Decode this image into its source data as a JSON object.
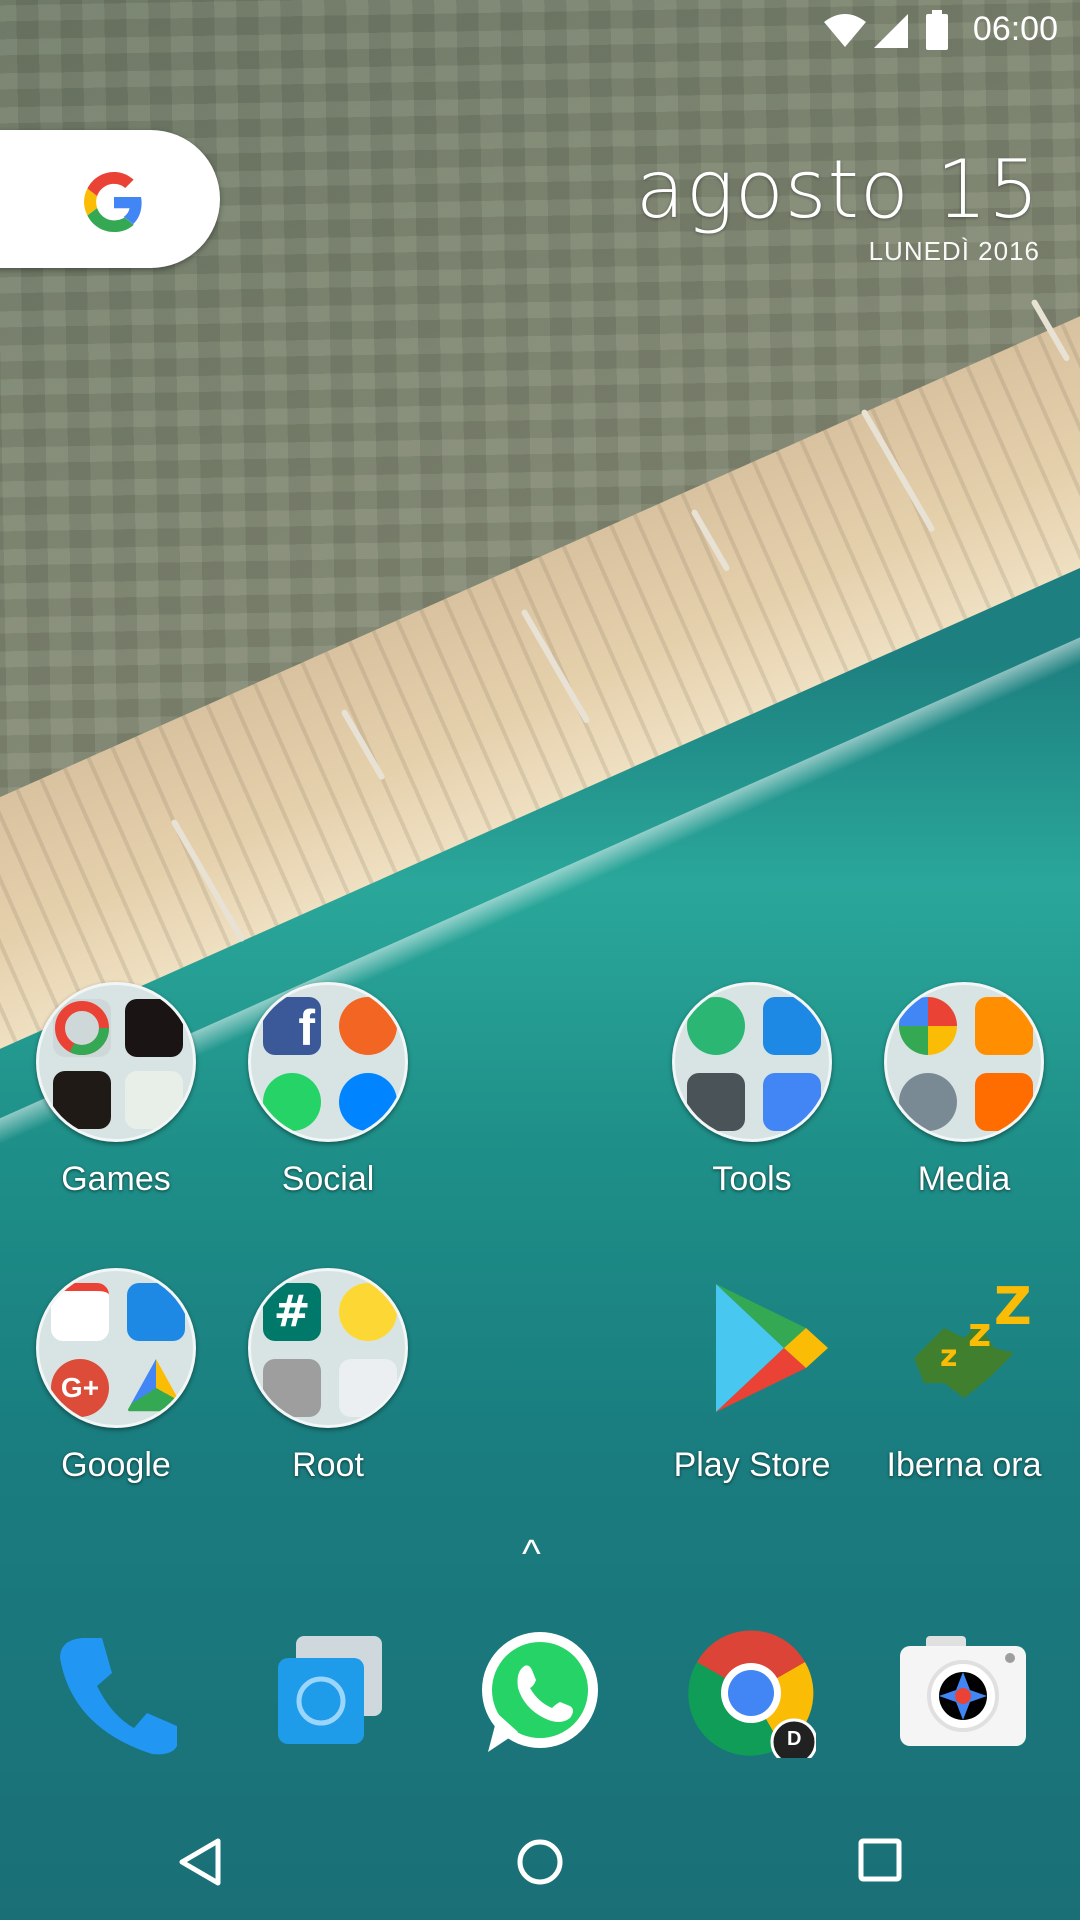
{
  "status_bar": {
    "time": "06:00",
    "icons": [
      "wifi-icon",
      "cell-signal-icon",
      "battery-icon"
    ]
  },
  "search_widget": {
    "icon": "google-g-icon"
  },
  "date_widget": {
    "date": "agosto 15",
    "weekday_year": "LUNEDÌ 2016"
  },
  "apps": [
    {
      "label": "Games",
      "type": "folder"
    },
    {
      "label": "Social",
      "type": "folder"
    },
    {
      "label": "Tools",
      "type": "folder"
    },
    {
      "label": "Media",
      "type": "folder"
    },
    {
      "label": "Google",
      "type": "folder"
    },
    {
      "label": "Root",
      "type": "folder"
    },
    {
      "label": "Play Store",
      "type": "app"
    },
    {
      "label": "Iberna ora",
      "type": "app"
    }
  ],
  "drawer_handle": "^",
  "dock": [
    {
      "name": "phone-icon"
    },
    {
      "name": "messages-icon"
    },
    {
      "name": "whatsapp-icon"
    },
    {
      "name": "chrome-icon",
      "badge": "D"
    },
    {
      "name": "camera-icon"
    }
  ],
  "nav_bar": [
    "back-icon",
    "home-icon",
    "recents-icon"
  ],
  "colors": {
    "sea": "#1d7f7f",
    "sand": "#e6d1ad",
    "google_blue": "#4285F4",
    "google_red": "#EA4335",
    "google_yellow": "#FBBC05",
    "google_green": "#34A853",
    "whatsapp_green": "#25D366"
  }
}
